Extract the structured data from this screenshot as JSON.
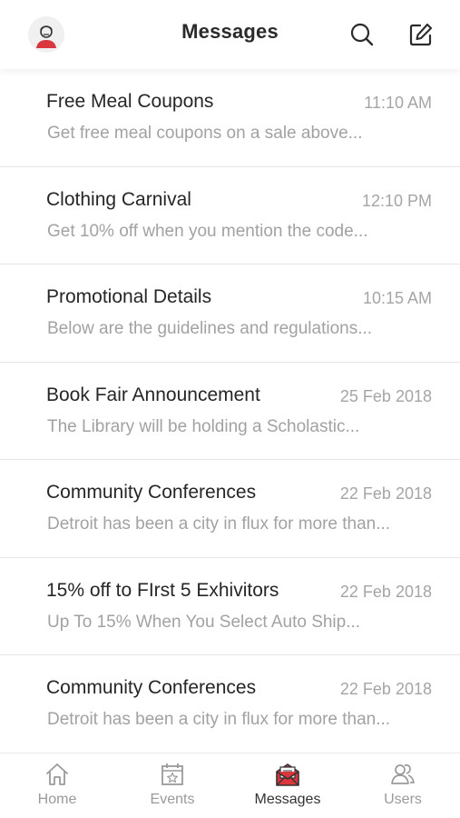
{
  "header": {
    "title": "Messages",
    "avatar_icon": "user-avatar-icon",
    "search_icon": "search-icon",
    "compose_icon": "compose-icon"
  },
  "messages": [
    {
      "subject": "Free Meal Coupons",
      "time": "11:10 AM",
      "preview": "Get free meal coupons on a sale above..."
    },
    {
      "subject": "Clothing Carnival",
      "time": "12:10 PM",
      "preview": "Get 10% off when you mention the code..."
    },
    {
      "subject": "Promotional Details",
      "time": "10:15 AM",
      "preview": "Below are the guidelines and regulations..."
    },
    {
      "subject": "Book Fair Announcement",
      "time": "25 Feb 2018",
      "preview": "The Library will be holding a Scholastic..."
    },
    {
      "subject": "Community Conferences",
      "time": "22 Feb 2018",
      "preview": "Detroit has been a city in flux for more than..."
    },
    {
      "subject": "15% off to FIrst 5 Exhivitors",
      "time": "22 Feb 2018",
      "preview": "Up To 15% When You Select Auto Ship..."
    },
    {
      "subject": "Community Conferences",
      "time": "22 Feb 2018",
      "preview": "Detroit has been a city in flux for more than..."
    }
  ],
  "tabs": [
    {
      "label": "Home",
      "icon": "home-icon",
      "active": false
    },
    {
      "label": "Events",
      "icon": "calendar-star-icon",
      "active": false
    },
    {
      "label": "Messages",
      "icon": "envelope-icon",
      "active": true
    },
    {
      "label": "Users",
      "icon": "users-icon",
      "active": false
    }
  ],
  "colors": {
    "accent_red": "#d9363e",
    "text_primary": "#262626",
    "text_secondary": "#a2a2a2",
    "divider": "#e6e6e6"
  }
}
